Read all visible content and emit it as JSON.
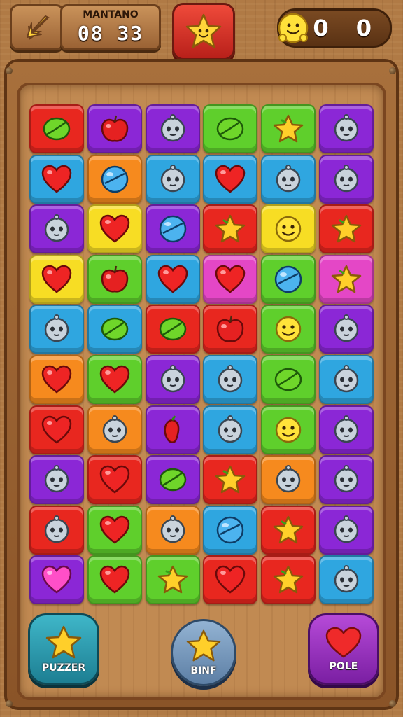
{
  "header": {
    "timer_label": "MANTANO",
    "timer_value": "08 33",
    "score": "0 0"
  },
  "colors": {
    "red": "#e8271f",
    "purple": "#8b27d6",
    "green": "#5fcf2c",
    "blue": "#2fa6e0",
    "orange": "#f68a1e",
    "yellow": "#f7dd24",
    "magenta": "#e447c6"
  },
  "board": {
    "rows": [
      [
        {
          "c": "red",
          "i": "leaf"
        },
        {
          "c": "purple",
          "i": "apple"
        },
        {
          "c": "purple",
          "i": "face"
        },
        {
          "c": "green",
          "i": "leaf"
        },
        {
          "c": "green",
          "i": "star"
        },
        {
          "c": "purple",
          "i": "face"
        }
      ],
      [
        {
          "c": "blue",
          "i": "heart"
        },
        {
          "c": "orange",
          "i": "disc"
        },
        {
          "c": "blue",
          "i": "face"
        },
        {
          "c": "blue",
          "i": "heart"
        },
        {
          "c": "blue",
          "i": "face"
        },
        {
          "c": "purple",
          "i": "face"
        }
      ],
      [
        {
          "c": "purple",
          "i": "face"
        },
        {
          "c": "yellow",
          "i": "heart"
        },
        {
          "c": "purple",
          "i": "disc"
        },
        {
          "c": "red",
          "i": "star"
        },
        {
          "c": "yellow",
          "i": "smile"
        },
        {
          "c": "red",
          "i": "star"
        }
      ],
      [
        {
          "c": "yellow",
          "i": "heart"
        },
        {
          "c": "green",
          "i": "apple"
        },
        {
          "c": "blue",
          "i": "heart"
        },
        {
          "c": "magenta",
          "i": "heart"
        },
        {
          "c": "green",
          "i": "disc"
        },
        {
          "c": "magenta",
          "i": "star"
        }
      ],
      [
        {
          "c": "blue",
          "i": "face"
        },
        {
          "c": "blue",
          "i": "leaf"
        },
        {
          "c": "red",
          "i": "leaf"
        },
        {
          "c": "red",
          "i": "apple"
        },
        {
          "c": "green",
          "i": "smile"
        },
        {
          "c": "purple",
          "i": "face"
        }
      ],
      [
        {
          "c": "orange",
          "i": "heart"
        },
        {
          "c": "green",
          "i": "heart"
        },
        {
          "c": "purple",
          "i": "face"
        },
        {
          "c": "blue",
          "i": "face"
        },
        {
          "c": "green",
          "i": "leaf"
        },
        {
          "c": "blue",
          "i": "face"
        }
      ],
      [
        {
          "c": "red",
          "i": "heart"
        },
        {
          "c": "orange",
          "i": "face"
        },
        {
          "c": "purple",
          "i": "pepper"
        },
        {
          "c": "blue",
          "i": "face"
        },
        {
          "c": "green",
          "i": "smile"
        },
        {
          "c": "purple",
          "i": "face"
        }
      ],
      [
        {
          "c": "purple",
          "i": "face"
        },
        {
          "c": "red",
          "i": "heart"
        },
        {
          "c": "purple",
          "i": "leaf"
        },
        {
          "c": "red",
          "i": "star"
        },
        {
          "c": "orange",
          "i": "face"
        },
        {
          "c": "purple",
          "i": "face"
        }
      ],
      [
        {
          "c": "red",
          "i": "face"
        },
        {
          "c": "green",
          "i": "heart"
        },
        {
          "c": "orange",
          "i": "face"
        },
        {
          "c": "blue",
          "i": "disc"
        },
        {
          "c": "red",
          "i": "star"
        },
        {
          "c": "purple",
          "i": "face"
        }
      ],
      [
        {
          "c": "purple",
          "i": "heart-pink"
        },
        {
          "c": "green",
          "i": "heart"
        },
        {
          "c": "green",
          "i": "star"
        },
        {
          "c": "red",
          "i": "heart"
        },
        {
          "c": "red",
          "i": "star"
        },
        {
          "c": "blue",
          "i": "face"
        }
      ]
    ]
  },
  "powerups": {
    "left_label": "PUZZER",
    "center_label": "BINF",
    "right_label": "POLE",
    "left_icon": "star-icon",
    "center_icon": "star-icon",
    "right_icon": "heart-icon"
  }
}
